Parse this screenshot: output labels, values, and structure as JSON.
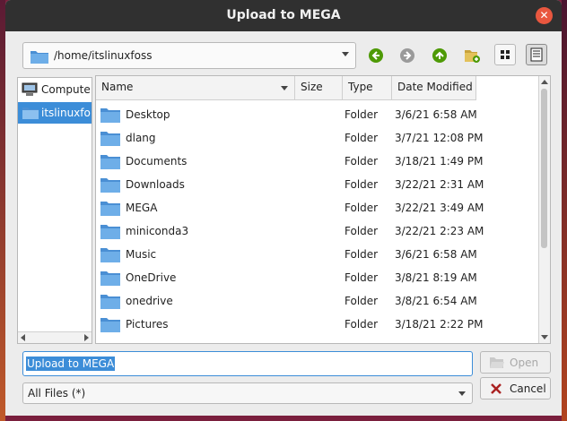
{
  "window": {
    "title": "Upload to MEGA",
    "close_glyph": "✕"
  },
  "toolbar": {
    "path": "/home/itslinuxfoss",
    "buttons": [
      {
        "name": "back-icon",
        "color": "#4e9a06"
      },
      {
        "name": "forward-icon",
        "color": "#9a9a9a"
      },
      {
        "name": "up-icon",
        "color": "#4e9a06"
      },
      {
        "name": "new-folder-icon",
        "color": "#c8a23a"
      },
      {
        "name": "icon-view-icon"
      },
      {
        "name": "list-view-icon",
        "active": true
      }
    ]
  },
  "places": [
    {
      "label": "Computer",
      "icon": "computer-icon",
      "selected": false
    },
    {
      "label": "itslinuxfoss",
      "icon": "folder-icon",
      "selected": true
    }
  ],
  "columns": {
    "name": "Name",
    "size": "Size",
    "type": "Type",
    "date": "Date Modified"
  },
  "files": [
    {
      "name": "Desktop",
      "size": "",
      "type": "Folder",
      "date": "3/6/21 6:58 AM"
    },
    {
      "name": "dlang",
      "size": "",
      "type": "Folder",
      "date": "3/7/21 12:08 PM"
    },
    {
      "name": "Documents",
      "size": "",
      "type": "Folder",
      "date": "3/18/21 1:49 PM"
    },
    {
      "name": "Downloads",
      "size": "",
      "type": "Folder",
      "date": "3/22/21 2:31 AM"
    },
    {
      "name": "MEGA",
      "size": "",
      "type": "Folder",
      "date": "3/22/21 3:49 AM"
    },
    {
      "name": "miniconda3",
      "size": "",
      "type": "Folder",
      "date": "3/22/21 2:23 AM"
    },
    {
      "name": "Music",
      "size": "",
      "type": "Folder",
      "date": "3/6/21 6:58 AM"
    },
    {
      "name": "OneDrive",
      "size": "",
      "type": "Folder",
      "date": "3/8/21 8:19 AM"
    },
    {
      "name": "onedrive",
      "size": "",
      "type": "Folder",
      "date": "3/8/21 6:54 AM"
    },
    {
      "name": "Pictures",
      "size": "",
      "type": "Folder",
      "date": "3/18/21 2:22 PM"
    }
  ],
  "filename_field": {
    "value": "Upload to MEGA"
  },
  "filter": {
    "selected": "All Files (*)"
  },
  "buttons": {
    "open": "Open",
    "cancel": "Cancel"
  },
  "colors": {
    "titlebar": "#303030",
    "selection": "#3c8dd8",
    "folder": "#5aa0e0",
    "close": "#e9573f"
  }
}
